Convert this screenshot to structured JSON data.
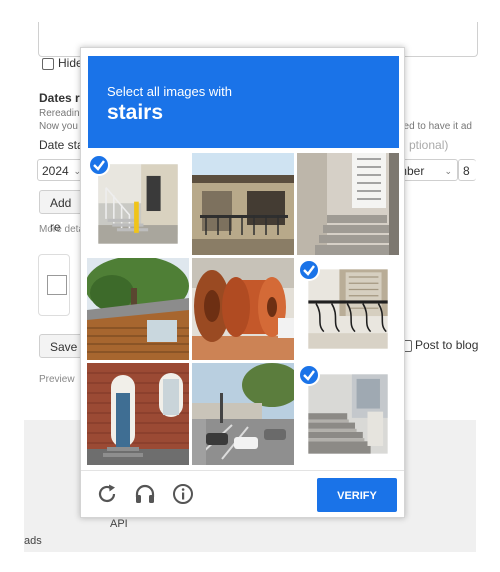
{
  "background": {
    "hide_label": "Hide",
    "dates_heading": "Dates re",
    "hint_line1": "Rereading",
    "hint_line2": "Now you c",
    "hint_right": "hed to have it ad",
    "date_label": "Date sta",
    "optional_text": "ptional)",
    "year_value": "2024",
    "month_value": "mber",
    "day_value": "8",
    "add_button": "Add re",
    "more_details": "More deta",
    "save_button": "Save",
    "post_to_blog": "Post to blog",
    "preview": "Preview",
    "footer_api": "API",
    "footer_ads": "ads"
  },
  "captcha": {
    "subtitle": "Select all images with",
    "target": "stairs",
    "verify_label": "VERIFY",
    "accent_color": "#1a73e8",
    "tiles": [
      {
        "scene": "exterior stairs with yellow bollard",
        "selected": true
      },
      {
        "scene": "building with balcony",
        "selected": false
      },
      {
        "scene": "house entrance steps",
        "selected": false
      },
      {
        "scene": "wooden house with tree",
        "selected": false
      },
      {
        "scene": "cable reels",
        "selected": false
      },
      {
        "scene": "iron balcony railing",
        "selected": true
      },
      {
        "scene": "brick building doorway",
        "selected": false
      },
      {
        "scene": "street intersection with cars",
        "selected": false
      },
      {
        "scene": "stone steps",
        "selected": true
      }
    ],
    "footer_icons": [
      "reload-icon",
      "audio-icon",
      "info-icon"
    ]
  }
}
